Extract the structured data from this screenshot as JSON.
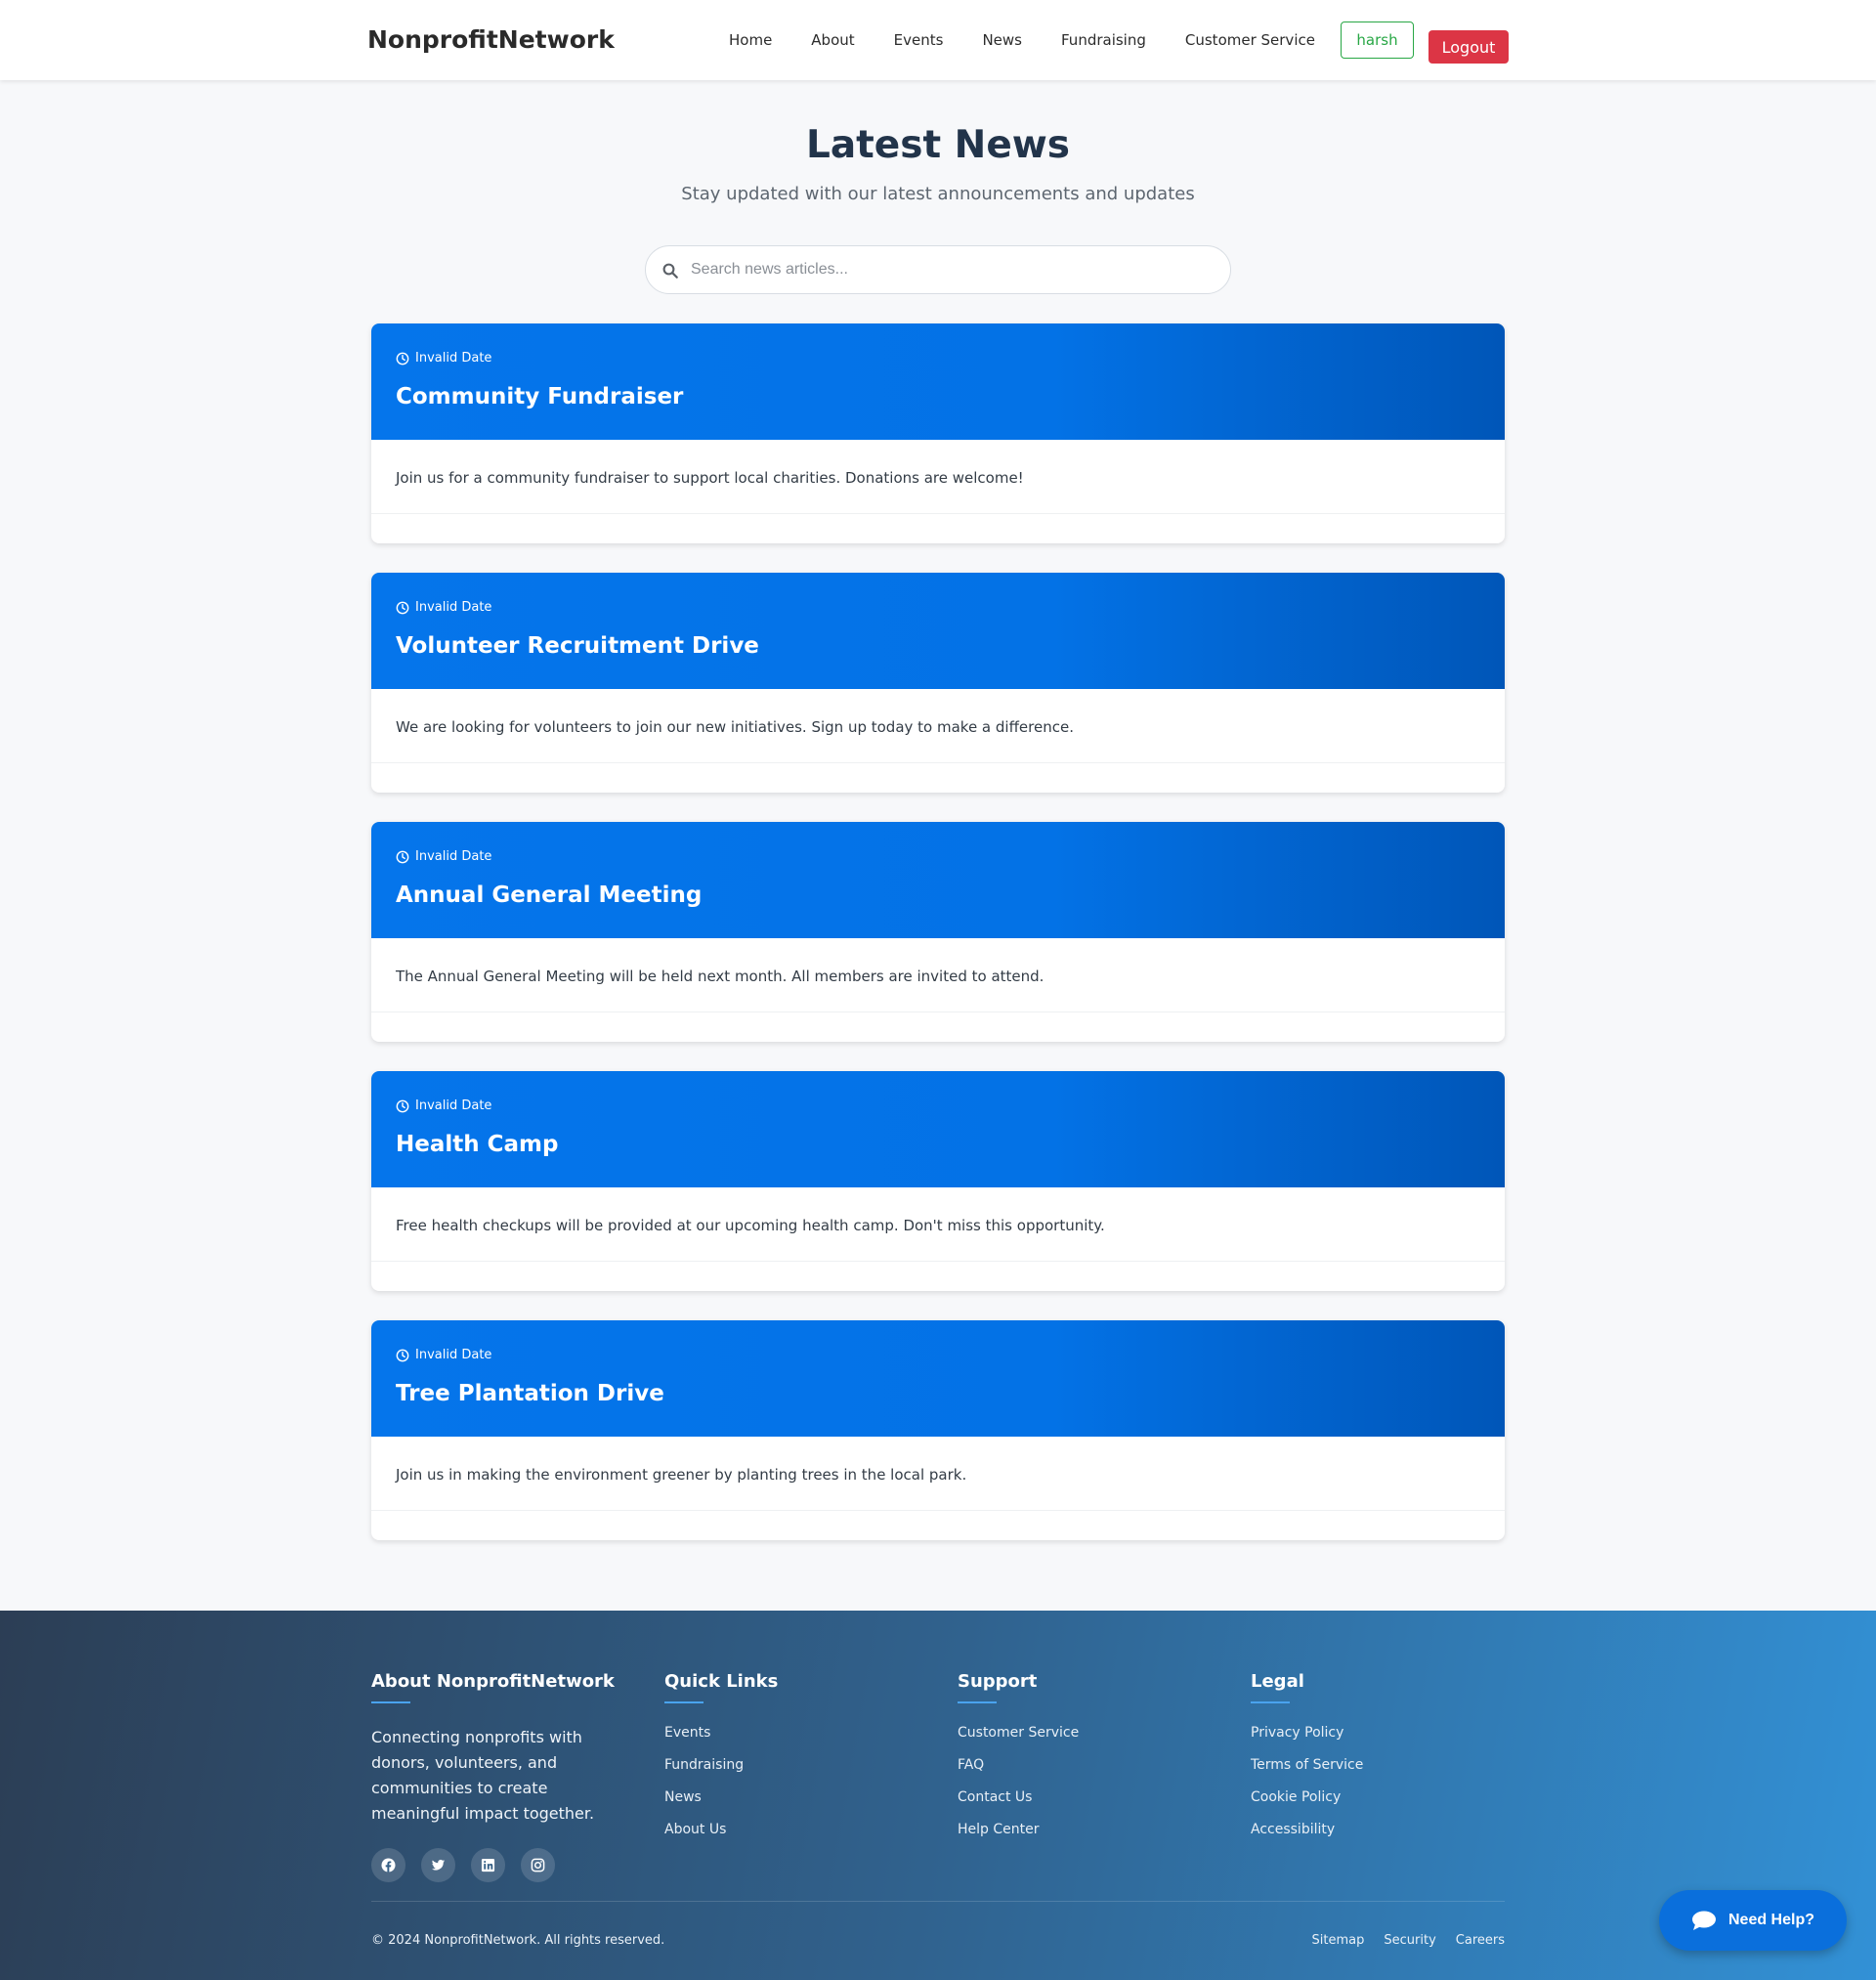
{
  "navbar": {
    "brand": "NonprofitNetwork",
    "links": [
      "Home",
      "About",
      "Events",
      "News",
      "Fundraising",
      "Customer Service"
    ],
    "user_label": "harsh",
    "logout_label": "Logout"
  },
  "header": {
    "title": "Latest News",
    "subtitle": "Stay updated with our latest announcements and updates"
  },
  "search": {
    "placeholder": "Search news articles...",
    "value": ""
  },
  "news": [
    {
      "date": "Invalid Date",
      "title": "Community Fundraiser",
      "body": "Join us for a community fundraiser to support local charities. Donations are welcome!"
    },
    {
      "date": "Invalid Date",
      "title": "Volunteer Recruitment Drive",
      "body": "We are looking for volunteers to join our new initiatives. Sign up today to make a difference."
    },
    {
      "date": "Invalid Date",
      "title": "Annual General Meeting",
      "body": "The Annual General Meeting will be held next month. All members are invited to attend."
    },
    {
      "date": "Invalid Date",
      "title": "Health Camp",
      "body": "Free health checkups will be provided at our upcoming health camp. Don't miss this opportunity."
    },
    {
      "date": "Invalid Date",
      "title": "Tree Plantation Drive",
      "body": "Join us in making the environment greener by planting trees in the local park."
    }
  ],
  "footer": {
    "about": {
      "heading": "About NonprofitNetwork",
      "text": "Connecting nonprofits with donors, volunteers, and communities to create meaningful impact together.",
      "social": [
        "facebook-icon",
        "twitter-icon",
        "linkedin-icon",
        "instagram-icon"
      ]
    },
    "quick_links": {
      "heading": "Quick Links",
      "items": [
        "Events",
        "Fundraising",
        "News",
        "About Us"
      ]
    },
    "support": {
      "heading": "Support",
      "items": [
        "Customer Service",
        "FAQ",
        "Contact Us",
        "Help Center"
      ]
    },
    "legal": {
      "heading": "Legal",
      "items": [
        "Privacy Policy",
        "Terms of Service",
        "Cookie Policy",
        "Accessibility"
      ]
    },
    "copyright": "© 2024 NonprofitNetwork. All rights reserved.",
    "bottom_links": [
      "Sitemap",
      "Security",
      "Careers"
    ]
  },
  "help_button": {
    "label": "Need Help?"
  },
  "colors": {
    "primary": "#0575eb",
    "danger": "#dc3545",
    "success": "#28a745",
    "footer_dark": "#2c3e55",
    "footer_light": "#3291d6"
  }
}
